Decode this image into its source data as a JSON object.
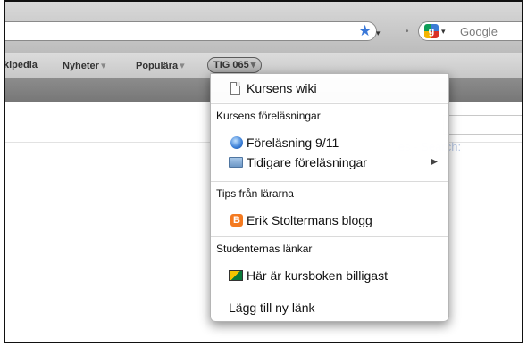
{
  "toolbar": {
    "search_placeholder": "Google",
    "search_engine_logo_letter": "g",
    "star_icon": "star-icon",
    "dropdown_caret": "▾"
  },
  "bookmarks": {
    "items": [
      {
        "label": "kipedia"
      },
      {
        "label": "Nyheter",
        "arrow": "▾"
      },
      {
        "label": "Populära",
        "arrow": "▾"
      },
      {
        "label": "TIG 065",
        "arrow": "▾"
      }
    ]
  },
  "content": {
    "ghost_link": "es - Search:"
  },
  "menu": {
    "items": [
      {
        "kind": "item",
        "label": "Kursens wiki",
        "icon": "page-icon"
      },
      {
        "kind": "header",
        "label": "Kursens föreläsningar"
      },
      {
        "kind": "item",
        "label": "Föreläsning 9/11",
        "icon": "globe-icon"
      },
      {
        "kind": "item",
        "label": "Tidigare föreläsningar",
        "icon": "folder-icon",
        "submenu_arrow": "▶"
      },
      {
        "kind": "header",
        "label": "Tips från lärarna"
      },
      {
        "kind": "item",
        "label": "Erik Stoltermans blogg",
        "icon": "blogger-icon",
        "icon_letter": "B"
      },
      {
        "kind": "header",
        "label": "Studenternas länkar"
      },
      {
        "kind": "item",
        "label": "Här är kursboken billigast",
        "icon": "book-icon"
      },
      {
        "kind": "item",
        "label": "Lägg till ny länk"
      }
    ]
  }
}
